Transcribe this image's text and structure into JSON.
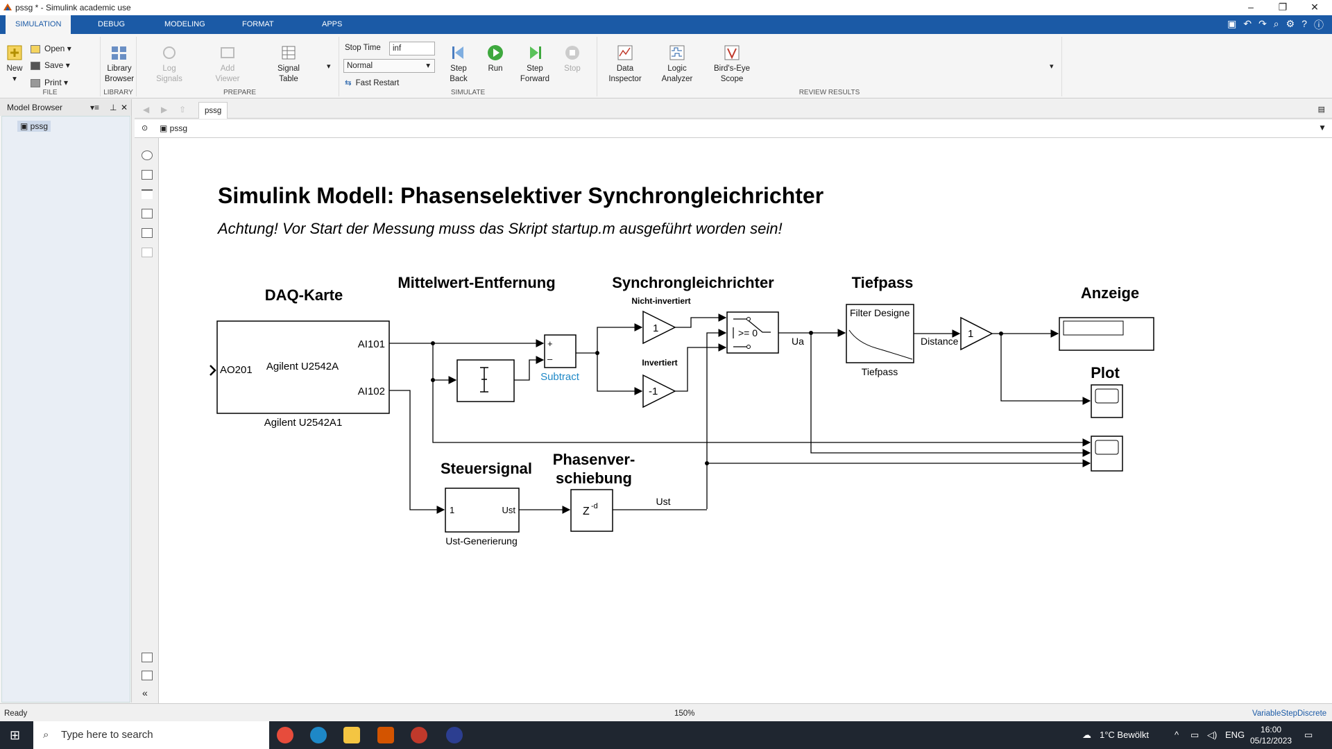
{
  "window": {
    "title": "pssg * - Simulink academic use"
  },
  "tabs": [
    "SIMULATION",
    "DEBUG",
    "MODELING",
    "FORMAT",
    "APPS"
  ],
  "ribbon": {
    "file": {
      "label": "FILE",
      "new": "New",
      "open": "Open",
      "save": "Save",
      "print": "Print"
    },
    "library": {
      "label": "LIBRARY",
      "browser": "Library Browser"
    },
    "prepare": {
      "label": "PREPARE",
      "log_signals": "Log Signals",
      "add_viewer": "Add Viewer",
      "signal_table": "Signal Table"
    },
    "simulate": {
      "label": "SIMULATE",
      "stop_time_label": "Stop Time",
      "stop_time_value": "inf",
      "mode": "Normal",
      "fast_restart": "Fast Restart",
      "step_back": "Step Back",
      "run": "Run",
      "step_forward": "Step Forward",
      "stop": "Stop"
    },
    "review": {
      "label": "REVIEW RESULTS",
      "data_inspector": "Data Inspector",
      "logic_analyzer": "Logic Analyzer",
      "birds_eye": "Bird's-Eye Scope"
    }
  },
  "browser": {
    "title": "Model Browser",
    "item": "pssg"
  },
  "address": {
    "tab": "pssg",
    "path": "pssg"
  },
  "model": {
    "title": "Simulink Modell: Phasenselektiver Synchrongleichrichter",
    "subtitle": "Achtung! Vor Start der Messung muss das Skript startup.m ausgeführt worden sein!",
    "sections": {
      "daq": "DAQ-Karte",
      "mittelwert": "Mittelwert-Entfernung",
      "synchron": "Synchrongleichrichter",
      "tiefpass": "Tiefpass",
      "anzeige": "Anzeige",
      "plot": "Plot",
      "steuersignal": "Steuersignal",
      "phasen1": "Phasenver-",
      "phasen2": "schiebung"
    },
    "daq_block": {
      "name": "Agilent U2542A",
      "label": "Agilent U2542A1",
      "in": "AO201",
      "out1": "AI101",
      "out2": "AI102"
    },
    "subtract": {
      "label": "Subtract",
      "plus": "+",
      "minus": "–"
    },
    "gain_ni": {
      "title": "Nicht-invertiert",
      "value": "1"
    },
    "gain_inv": {
      "title": "Invertiert",
      "value": "-1"
    },
    "switch": {
      "label": ">= 0"
    },
    "signal_ua": "Ua",
    "filter": {
      "name": "Filter Designe",
      "label": "Tiefpass"
    },
    "signal_distance": "Distance",
    "gain_out": {
      "value": "1"
    },
    "ust_block": {
      "in": "1",
      "out": "Ust",
      "label": "Ust-Generierung"
    },
    "delay": {
      "text": "Z",
      "exp": "-d"
    },
    "signal_ust": "Ust"
  },
  "status": {
    "ready": "Ready",
    "zoom": "150%",
    "solver": "VariableStepDiscrete"
  },
  "taskbar": {
    "search": "Type here to search",
    "weather": "1°C Bewölkt",
    "lang": "ENG",
    "time": "16:00",
    "date": "05/12/2023"
  },
  "colors": {
    "tabstrip": "#1b5aa6",
    "subtract_label": "#1e88c7"
  }
}
